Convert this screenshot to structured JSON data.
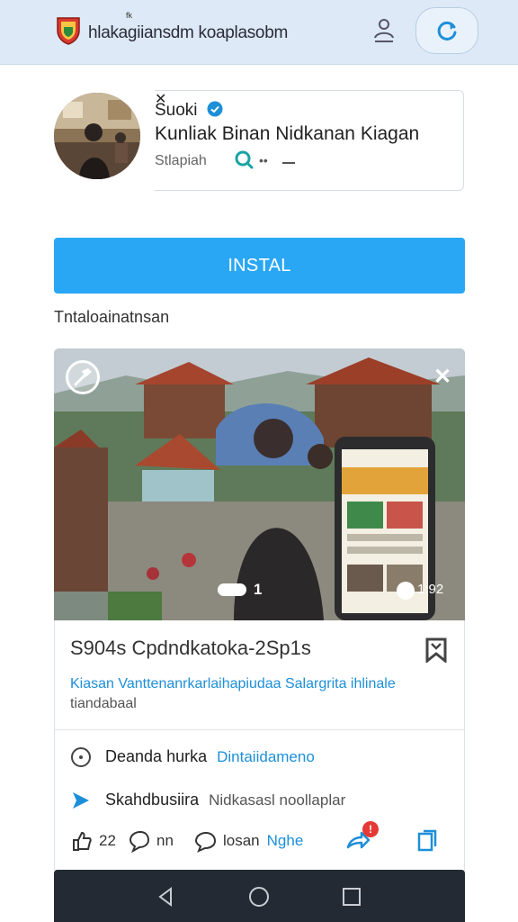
{
  "header": {
    "logo_mark": "fk",
    "title": "hlakagiiansdm koaplasobm"
  },
  "profile": {
    "name": "Suoki",
    "subtitle": "Kunliak Binan Nidkanan Kiagan",
    "meta_label": "Stlapiah",
    "meta_dots": "••"
  },
  "install": {
    "button_label": "INSTAL",
    "caption": "Tntaloainatnsan"
  },
  "post": {
    "photo_count": "1",
    "photo_time": "1:92",
    "title": "S904s Cpdndkatoka-2Sp1s",
    "link_text": "Kiasan Vanttenanrkarlaihapiudaa Salargrita ihlinale",
    "handle": "tiandabaal",
    "rows": [
      {
        "label": "Deanda hurka",
        "value": "Dintaiidameno"
      },
      {
        "label": "Skahdbusiira",
        "value": "Nidkasasl noollaplar"
      }
    ],
    "actions": {
      "likes": "22",
      "replies": "nn",
      "comment_label": "losan",
      "comment_value": "Nghe",
      "notification_count": "!"
    }
  },
  "colors": {
    "accent": "#2aa7f4",
    "link": "#1d8fd8",
    "header_bg": "#dde9f6",
    "navbar_bg": "#232a33"
  }
}
